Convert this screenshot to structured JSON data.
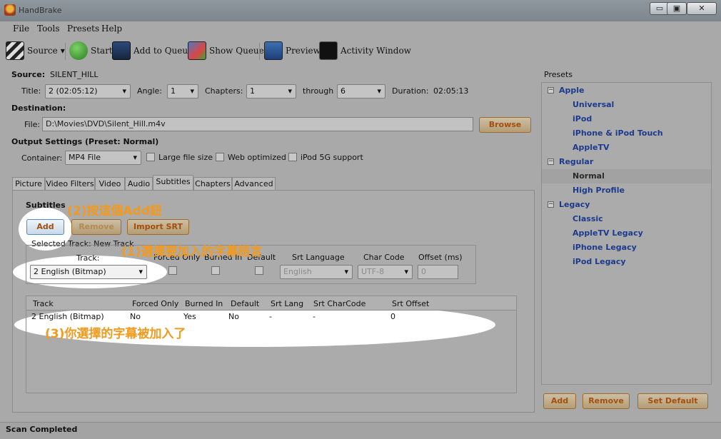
{
  "window": {
    "title": "HandBrake",
    "btn_min": "▭",
    "btn_max": "▣",
    "btn_close": "✕"
  },
  "menu": [
    "File",
    "Tools",
    "Presets",
    "Help"
  ],
  "toolbar": {
    "source": "Source",
    "start": "Start",
    "add_queue": "Add to Queue",
    "show_queue": "Show Queue",
    "preview": "Preview",
    "activity": "Activity Window"
  },
  "source": {
    "label": "Source:",
    "value": "SILENT_HILL"
  },
  "title_row": {
    "title_label": "Title:",
    "title_value": "2 (02:05:12)",
    "angle_label": "Angle:",
    "angle_value": "1",
    "chapters_label": "Chapters:",
    "chapter_start": "1",
    "through_label": "through",
    "chapter_end": "6",
    "duration_label": "Duration:",
    "duration_value": "02:05:13"
  },
  "destination": {
    "heading": "Destination:",
    "file_label": "File:",
    "file_value": "D:\\Movies\\DVD\\Silent_Hill.m4v",
    "browse": "Browse"
  },
  "output": {
    "heading": "Output Settings (Preset: Normal)",
    "container_label": "Container:",
    "container_value": "MP4 File",
    "large_file": "Large file size",
    "web_opt": "Web optimized",
    "ipod": "iPod 5G support"
  },
  "tabs": [
    "Picture",
    "Video Filters",
    "Video",
    "Audio",
    "Subtitles",
    "Chapters",
    "Advanced"
  ],
  "subtitles": {
    "heading": "Subtitles",
    "add": "Add",
    "remove": "Remove",
    "import_srt": "Import SRT",
    "selected_track": "Selected Track: New Track",
    "track_label": "Track:",
    "track_value": "2 English (Bitmap)",
    "forced_only": "Forced Only",
    "burned_in": "Burned In",
    "default": "Default",
    "srt_language": "Srt Language",
    "srt_language_value": "English",
    "char_code": "Char Code",
    "char_code_value": "UTF-8",
    "offset": "Offset (ms)",
    "offset_value": "0",
    "table_headers": [
      "Track",
      "Forced Only",
      "Burned In",
      "Default",
      "Srt Lang",
      "Srt CharCode",
      "Srt Offset"
    ],
    "table_rows": [
      [
        "2 English (Bitmap)",
        "No",
        "Yes",
        "No",
        "-",
        "-",
        "0"
      ]
    ]
  },
  "annotations": {
    "step2": "(2)按這個Add鈕",
    "step1": "(1)選擇要加入的字幕語言",
    "step3": "(3)你選擇的字幕被加入了"
  },
  "presets": {
    "heading": "Presets",
    "groups": [
      {
        "name": "Apple",
        "items": [
          "Universal",
          "iPod",
          "iPhone & iPod Touch",
          "AppleTV"
        ]
      },
      {
        "name": "Regular",
        "items": [
          "Normal",
          "High Profile"
        ]
      },
      {
        "name": "Legacy",
        "items": [
          "Classic",
          "AppleTV Legacy",
          "iPhone Legacy",
          "iPod Legacy"
        ]
      }
    ],
    "add": "Add",
    "remove": "Remove",
    "set_default": "Set Default"
  },
  "status": "Scan Completed",
  "colors": {
    "annotation": "#f29a1e",
    "preset_text": "#1d3a8c",
    "button_text": "#a24f10"
  }
}
